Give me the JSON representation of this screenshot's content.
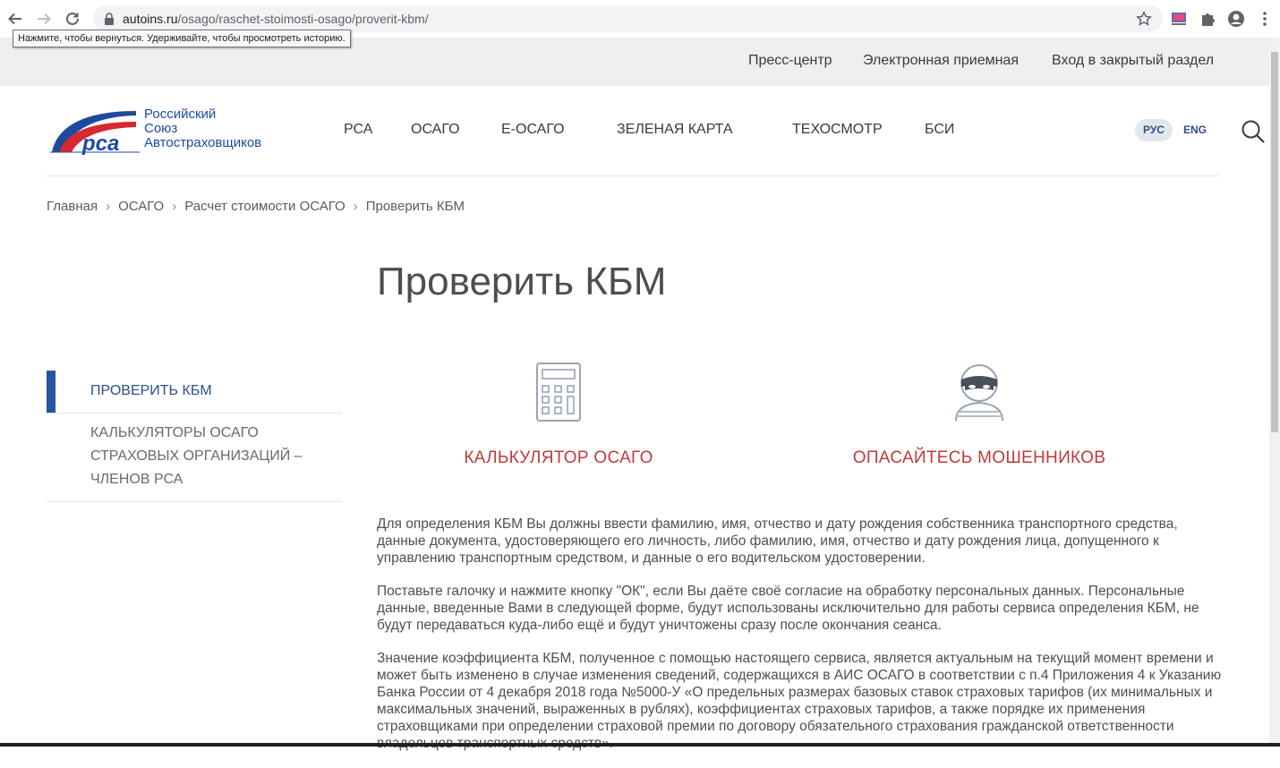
{
  "browser": {
    "url_host": "autoins.ru",
    "url_path": "/osago/raschet-stoimosti-osago/proverit-kbm/",
    "tooltip": "Нажмите, чтобы вернуться. Удерживайте, чтобы просмотреть историю."
  },
  "topbar": {
    "links": [
      "Пресс-центр",
      "Электронная приемная",
      "Вход в закрытый раздел"
    ]
  },
  "logo": {
    "line1": "Российский",
    "line2": "Союз",
    "line3": "Автостраховщиков",
    "mark": "рса"
  },
  "mainnav": [
    "РСА",
    "ОСАГО",
    "Е-ОСАГО",
    "ЗЕЛЕНАЯ КАРТА",
    "ТЕХОСМОТР",
    "БСИ"
  ],
  "lang": {
    "rus": "РУС",
    "eng": "ENG"
  },
  "breadcrumb": [
    "Главная",
    "ОСАГО",
    "Расчет стоимости ОСАГО",
    "Проверить КБМ"
  ],
  "page_title": "Проверить КБМ",
  "sidebar": {
    "items": [
      {
        "label": "ПРОВЕРИТЬ КБМ"
      },
      {
        "label": "КАЛЬКУЛЯТОРЫ ОСАГО СТРАХОВЫХ ОРГАНИЗАЦИЙ – ЧЛЕНОВ РСА"
      }
    ]
  },
  "cards": [
    {
      "title": "КАЛЬКУЛЯТОР ОСАГО",
      "icon": "calculator-icon"
    },
    {
      "title": "ОПАСАЙТЕСЬ МОШЕННИКОВ",
      "icon": "fraudster-icon"
    }
  ],
  "body": {
    "p1": "Для определения КБМ Вы должны ввести фамилию, имя, отчество и дату рождения собственника транспортного средства, данные документа, удостоверяющего его личность, либо фамилию, имя, отчество и дату рождения лица, допущенного к управлению транспортным средством, и данные о его водительском удостоверении.",
    "p2": "Поставьте галочку и нажмите кнопку \"ОК\", если Вы даёте своё согласие на обработку персональных данных. Персональные данные, введенные Вами в следующей форме, будут использованы исключительно для работы сервиса определения КБМ, не будут передаваться куда-либо ещё и будут уничтожены сразу после окончания сеанса.",
    "p3": "Значение коэффициента КБМ, полученное с помощью настоящего сервиса, является актуальным на текущий момент времени и может быть изменено в случае изменения сведений, содержащихся в АИС ОСАГО в соответствии с п.4 Приложения 4 к Указанию Банка России от 4 декабря 2018 года №5000-У «О предельных размерах базовых ставок страховых тарифов (их минимальных и максимальных значений, выраженных в рублях), коэффициентах страховых тарифов, а также порядке их применения страховщиками при определении страховой премии по договору обязательного страхования гражданской ответственности владельцев транспортных средств»."
  },
  "colors": {
    "accent_blue": "#2654a0",
    "accent_red": "#c0393b",
    "topbar_bg": "#efefef"
  }
}
